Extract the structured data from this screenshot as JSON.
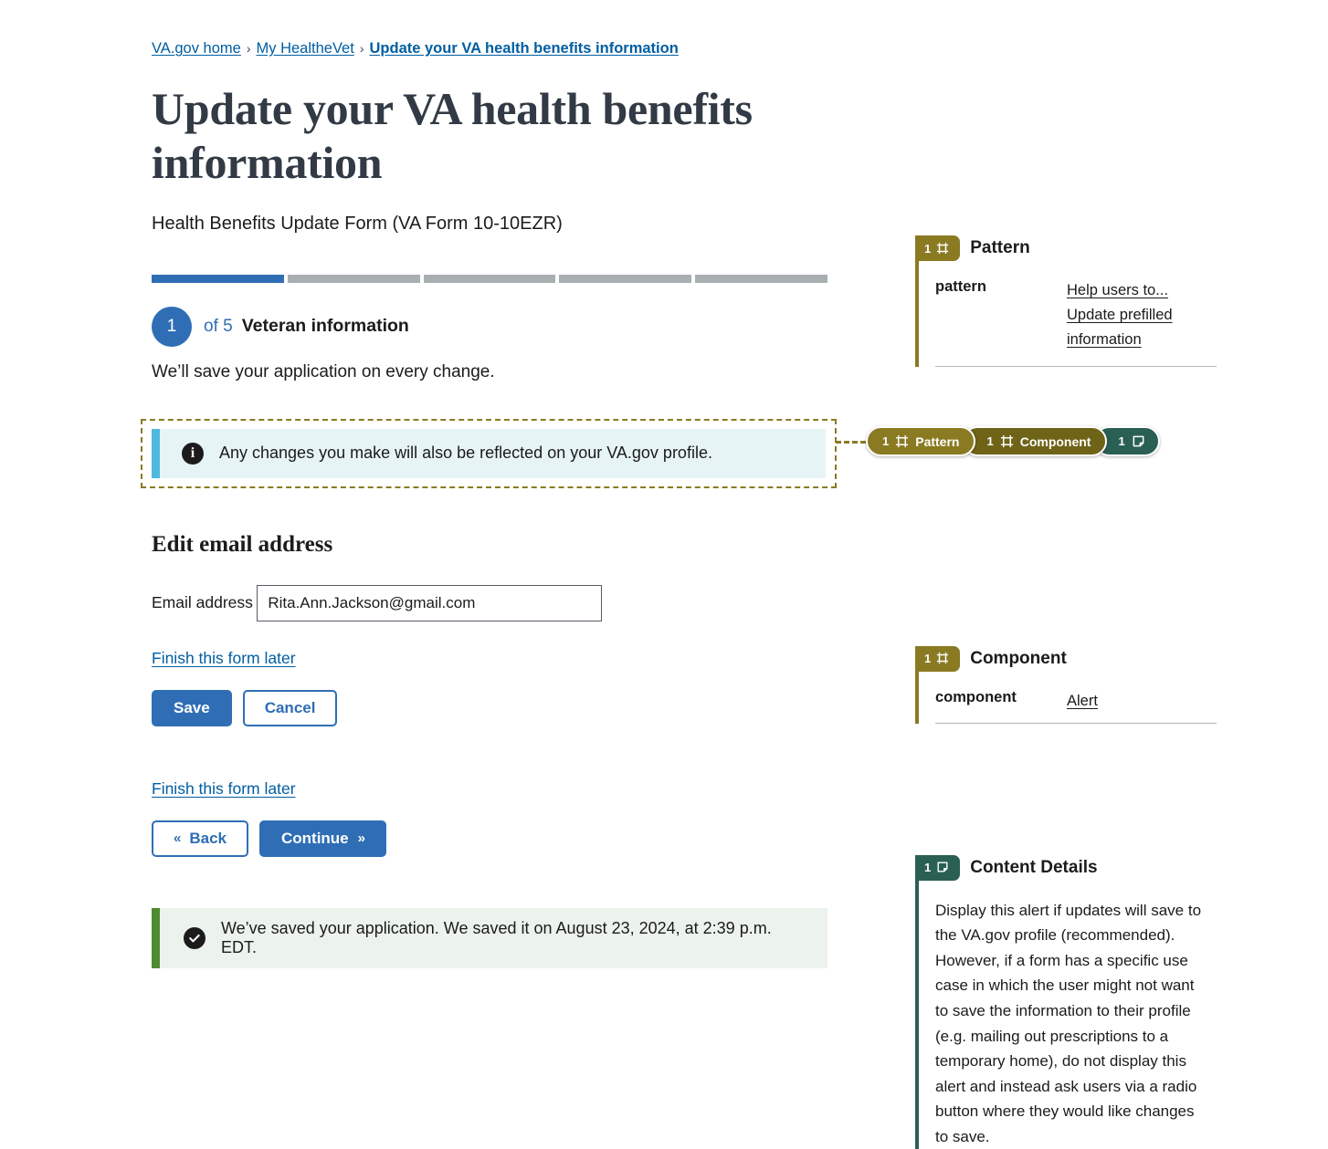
{
  "breadcrumb": {
    "items": [
      {
        "label": "VA.gov home",
        "current": false
      },
      {
        "label": "My HealtheVet",
        "current": false
      },
      {
        "label": "Update your VA health benefits information",
        "current": true
      }
    ],
    "separator": "›"
  },
  "header": {
    "title": "Update your VA health benefits information",
    "subtitle": "Health Benefits Update Form (VA Form 10-10EZR)"
  },
  "progress": {
    "total_segments": 5,
    "completed_segments": 1,
    "fill_color": "#2f6eb5",
    "track_color": "#a9aeb1"
  },
  "step": {
    "number": "1",
    "of_label": "of 5",
    "name": "Veteran information",
    "note": "We’ll save your application on every change."
  },
  "info_alert": {
    "icon": "info-icon",
    "glyph": "i",
    "text": "Any changes you make will also be reflected on your VA.gov profile.",
    "background": "#e7f4f6",
    "accent": "#4fb8de",
    "selected": true,
    "selection_border_color": "#8a7a22"
  },
  "annotation_pills": [
    {
      "count": "1",
      "label": "Pattern",
      "icon": "frame-icon",
      "color": "#8a7a22"
    },
    {
      "count": "1",
      "label": "Component",
      "icon": "frame-icon",
      "color": "#6f6318"
    },
    {
      "count": "1",
      "label": "",
      "icon": "note-icon",
      "color": "#2a5f54"
    }
  ],
  "email_section": {
    "heading": "Edit email address",
    "field_label": "Email address",
    "email_value": "Rita.Ann.Jackson@gmail.com",
    "email_placeholder": "Email address",
    "finish_link": "Finish this form later",
    "save_label": "Save",
    "cancel_label": "Cancel"
  },
  "nav_section": {
    "finish_link": "Finish this form later",
    "back_label": "Back",
    "back_chevron": "«",
    "continue_label": "Continue",
    "continue_chevron": "»"
  },
  "success_alert": {
    "icon": "check-icon",
    "text": "We’ve saved your application. We saved it on August 23, 2024, at 2:39 p.m. EDT.",
    "background": "#ecf3ec",
    "accent": "#4d8b31"
  },
  "sidebar": {
    "pattern_card": {
      "badge_count": "1",
      "badge_icon": "frame-icon",
      "title": "Pattern",
      "key": "pattern",
      "value": "Help users to... Update prefilled information",
      "color": "#8a7a22"
    },
    "component_card": {
      "badge_count": "1",
      "badge_icon": "frame-icon",
      "title": "Component",
      "key": "component",
      "value": "Alert",
      "color": "#8a7a22"
    },
    "content_details_card": {
      "badge_count": "1",
      "badge_icon": "note-icon",
      "title": "Content Details",
      "body": "Display this alert if updates will save to the VA.gov profile (recommended). However, if a form has a specific use case in which the user might not want to save the information to their profile (e.g. mailing out prescriptions to a temporary home), do not display this alert and instead ask users via a radio button where they would like changes to save.",
      "color": "#2a5f54"
    }
  }
}
